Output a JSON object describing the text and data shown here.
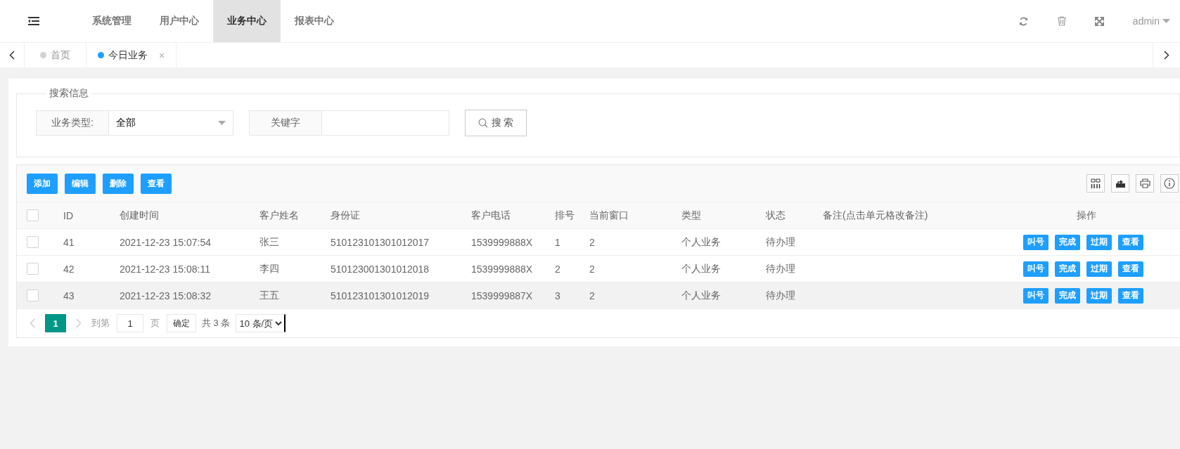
{
  "header": {
    "menu_items": [
      {
        "label": "系统管理",
        "selected": false
      },
      {
        "label": "用户中心",
        "selected": false
      },
      {
        "label": "业务中心",
        "selected": true
      },
      {
        "label": "报表中心",
        "selected": false
      }
    ],
    "user": "admin"
  },
  "page_tabs": [
    {
      "label": "首页",
      "selected": false
    },
    {
      "label": "今日业务",
      "selected": true,
      "close": "×"
    }
  ],
  "search": {
    "legend": "搜索信息",
    "fields": [
      {
        "kind": "select",
        "label": "业务类型:",
        "value": "全部"
      },
      {
        "kind": "text",
        "label": "关键字"
      }
    ],
    "button": "搜 索"
  },
  "toolbar": {
    "buttons": [
      "添加",
      "编辑",
      "删除",
      "查看"
    ]
  },
  "table": {
    "header_checked": false,
    "columns": [
      "ID",
      "创建时间",
      "客户姓名",
      "身份证",
      "客户电话",
      "排号",
      "当前窗口",
      "类型",
      "状态",
      "备注(点击单元格改备注)",
      "操作"
    ],
    "rows": [
      {
        "checked": false,
        "highlighted": false,
        "cells": [
          "41",
          "2021-12-23 15:07:54",
          "张三",
          "510123101301012017",
          "1539999888X",
          "1",
          "2",
          "个人业务",
          "待办理"
        ],
        "actions": [
          "叫号",
          "完成",
          "过期",
          "查看"
        ]
      },
      {
        "checked": false,
        "highlighted": false,
        "cells": [
          "42",
          "2021-12-23 15:08:11",
          "李四",
          "510123001301012018",
          "1539999888X",
          "2",
          "2",
          "个人业务",
          "待办理"
        ],
        "actions": [
          "叫号",
          "完成",
          "过期",
          "查看"
        ]
      },
      {
        "checked": false,
        "highlighted": true,
        "cells": [
          "43",
          "2021-12-23 15:08:32",
          "王五",
          "510123101301012019",
          "1539999887X",
          "3",
          "2",
          "个人业务",
          "待办理"
        ],
        "actions": [
          "叫号",
          "完成",
          "过期",
          "查看"
        ]
      }
    ]
  },
  "pagination": {
    "pages": [
      {
        "label": "1",
        "selected": true
      }
    ],
    "goto_label": "到第",
    "goto_value": "1",
    "page_unit": "页",
    "confirm": "确定",
    "total": "共 3 条",
    "page_size": "10 条/页"
  }
}
